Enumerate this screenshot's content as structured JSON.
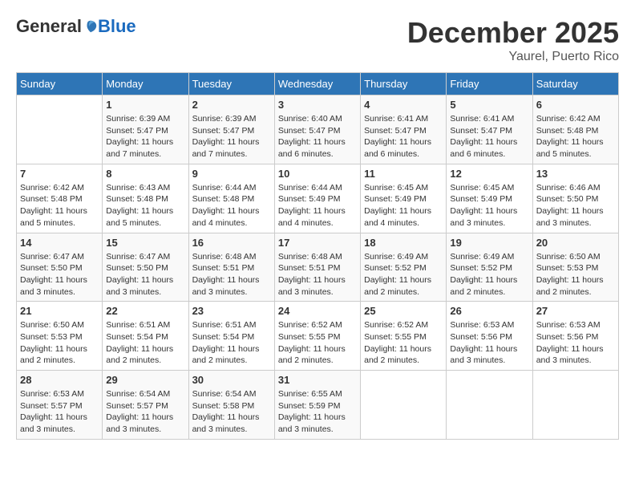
{
  "header": {
    "logo_general": "General",
    "logo_blue": "Blue",
    "month": "December 2025",
    "location": "Yaurel, Puerto Rico"
  },
  "weekdays": [
    "Sunday",
    "Monday",
    "Tuesday",
    "Wednesday",
    "Thursday",
    "Friday",
    "Saturday"
  ],
  "weeks": [
    [
      {
        "day": "",
        "info": ""
      },
      {
        "day": "1",
        "info": "Sunrise: 6:39 AM\nSunset: 5:47 PM\nDaylight: 11 hours\nand 7 minutes."
      },
      {
        "day": "2",
        "info": "Sunrise: 6:39 AM\nSunset: 5:47 PM\nDaylight: 11 hours\nand 7 minutes."
      },
      {
        "day": "3",
        "info": "Sunrise: 6:40 AM\nSunset: 5:47 PM\nDaylight: 11 hours\nand 6 minutes."
      },
      {
        "day": "4",
        "info": "Sunrise: 6:41 AM\nSunset: 5:47 PM\nDaylight: 11 hours\nand 6 minutes."
      },
      {
        "day": "5",
        "info": "Sunrise: 6:41 AM\nSunset: 5:47 PM\nDaylight: 11 hours\nand 6 minutes."
      },
      {
        "day": "6",
        "info": "Sunrise: 6:42 AM\nSunset: 5:48 PM\nDaylight: 11 hours\nand 5 minutes."
      }
    ],
    [
      {
        "day": "7",
        "info": "Sunrise: 6:42 AM\nSunset: 5:48 PM\nDaylight: 11 hours\nand 5 minutes."
      },
      {
        "day": "8",
        "info": "Sunrise: 6:43 AM\nSunset: 5:48 PM\nDaylight: 11 hours\nand 5 minutes."
      },
      {
        "day": "9",
        "info": "Sunrise: 6:44 AM\nSunset: 5:48 PM\nDaylight: 11 hours\nand 4 minutes."
      },
      {
        "day": "10",
        "info": "Sunrise: 6:44 AM\nSunset: 5:49 PM\nDaylight: 11 hours\nand 4 minutes."
      },
      {
        "day": "11",
        "info": "Sunrise: 6:45 AM\nSunset: 5:49 PM\nDaylight: 11 hours\nand 4 minutes."
      },
      {
        "day": "12",
        "info": "Sunrise: 6:45 AM\nSunset: 5:49 PM\nDaylight: 11 hours\nand 3 minutes."
      },
      {
        "day": "13",
        "info": "Sunrise: 6:46 AM\nSunset: 5:50 PM\nDaylight: 11 hours\nand 3 minutes."
      }
    ],
    [
      {
        "day": "14",
        "info": "Sunrise: 6:47 AM\nSunset: 5:50 PM\nDaylight: 11 hours\nand 3 minutes."
      },
      {
        "day": "15",
        "info": "Sunrise: 6:47 AM\nSunset: 5:50 PM\nDaylight: 11 hours\nand 3 minutes."
      },
      {
        "day": "16",
        "info": "Sunrise: 6:48 AM\nSunset: 5:51 PM\nDaylight: 11 hours\nand 3 minutes."
      },
      {
        "day": "17",
        "info": "Sunrise: 6:48 AM\nSunset: 5:51 PM\nDaylight: 11 hours\nand 3 minutes."
      },
      {
        "day": "18",
        "info": "Sunrise: 6:49 AM\nSunset: 5:52 PM\nDaylight: 11 hours\nand 2 minutes."
      },
      {
        "day": "19",
        "info": "Sunrise: 6:49 AM\nSunset: 5:52 PM\nDaylight: 11 hours\nand 2 minutes."
      },
      {
        "day": "20",
        "info": "Sunrise: 6:50 AM\nSunset: 5:53 PM\nDaylight: 11 hours\nand 2 minutes."
      }
    ],
    [
      {
        "day": "21",
        "info": "Sunrise: 6:50 AM\nSunset: 5:53 PM\nDaylight: 11 hours\nand 2 minutes."
      },
      {
        "day": "22",
        "info": "Sunrise: 6:51 AM\nSunset: 5:54 PM\nDaylight: 11 hours\nand 2 minutes."
      },
      {
        "day": "23",
        "info": "Sunrise: 6:51 AM\nSunset: 5:54 PM\nDaylight: 11 hours\nand 2 minutes."
      },
      {
        "day": "24",
        "info": "Sunrise: 6:52 AM\nSunset: 5:55 PM\nDaylight: 11 hours\nand 2 minutes."
      },
      {
        "day": "25",
        "info": "Sunrise: 6:52 AM\nSunset: 5:55 PM\nDaylight: 11 hours\nand 2 minutes."
      },
      {
        "day": "26",
        "info": "Sunrise: 6:53 AM\nSunset: 5:56 PM\nDaylight: 11 hours\nand 3 minutes."
      },
      {
        "day": "27",
        "info": "Sunrise: 6:53 AM\nSunset: 5:56 PM\nDaylight: 11 hours\nand 3 minutes."
      }
    ],
    [
      {
        "day": "28",
        "info": "Sunrise: 6:53 AM\nSunset: 5:57 PM\nDaylight: 11 hours\nand 3 minutes."
      },
      {
        "day": "29",
        "info": "Sunrise: 6:54 AM\nSunset: 5:57 PM\nDaylight: 11 hours\nand 3 minutes."
      },
      {
        "day": "30",
        "info": "Sunrise: 6:54 AM\nSunset: 5:58 PM\nDaylight: 11 hours\nand 3 minutes."
      },
      {
        "day": "31",
        "info": "Sunrise: 6:55 AM\nSunset: 5:59 PM\nDaylight: 11 hours\nand 3 minutes."
      },
      {
        "day": "",
        "info": ""
      },
      {
        "day": "",
        "info": ""
      },
      {
        "day": "",
        "info": ""
      }
    ]
  ]
}
